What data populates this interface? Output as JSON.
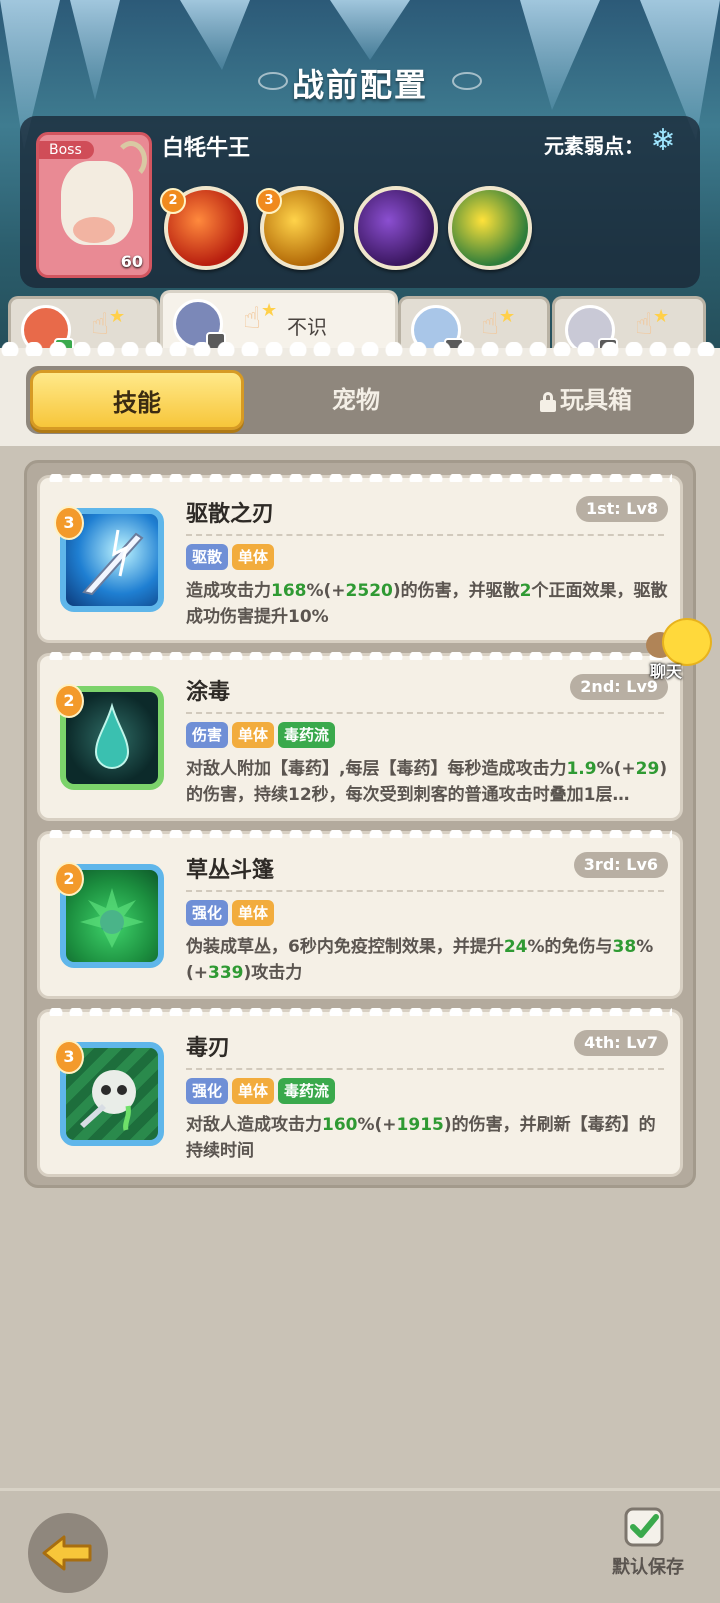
{
  "header": {
    "title": "战前配置"
  },
  "boss": {
    "tag": "Boss",
    "name": "白牦牛王",
    "level": "60",
    "element_weakness_label": "元素弱点：",
    "weakness_icon": "snowflake-icon",
    "skills": [
      {
        "icon": "fire-claw-icon",
        "badge": "2",
        "colors": [
          "#ff8a3d",
          "#b81e0f"
        ]
      },
      {
        "icon": "golden-swirl-icon",
        "badge": "3",
        "colors": [
          "#ffd34a",
          "#b36a08"
        ]
      },
      {
        "icon": "roaring-beast-icon",
        "badge": "",
        "colors": [
          "#8b4fd1",
          "#3b1760"
        ]
      },
      {
        "icon": "rock-golem-icon",
        "badge": "",
        "colors": [
          "#ffe23a",
          "#2f7d3a"
        ]
      }
    ]
  },
  "hero_tabs": [
    {
      "avatar_color": "#e86a4a",
      "label": ""
    },
    {
      "avatar_color": "#7b88b8",
      "label": "不识"
    },
    {
      "avatar_color": "#a9c6e8",
      "label": ""
    },
    {
      "avatar_color": "#c9c9d6",
      "label": ""
    }
  ],
  "category_tabs": {
    "skills": "技能",
    "pets": "宠物",
    "toybox": "玩具箱"
  },
  "skills": [
    {
      "name": "驱散之刃",
      "level_badge": "3",
      "rank": "1st: Lv8",
      "icon": "lightning-blade-icon",
      "frame": "blue",
      "tags": [
        {
          "text": "驱散",
          "color": "blue"
        },
        {
          "text": "单体",
          "color": "orange"
        }
      ],
      "desc_parts": [
        {
          "t": "造成攻击力",
          "hl": false
        },
        {
          "t": "168",
          "hl": true
        },
        {
          "t": "%(+",
          "hl": false
        },
        {
          "t": "2520",
          "hl": true
        },
        {
          "t": ")的伤害，并驱散",
          "hl": false
        },
        {
          "t": "2",
          "hl": true
        },
        {
          "t": "个正面效果，驱散成功伤害提升10%",
          "hl": false
        }
      ]
    },
    {
      "name": "涂毒",
      "level_badge": "2",
      "rank": "2nd: Lv9",
      "icon": "poison-drop-icon",
      "frame": "green",
      "tags": [
        {
          "text": "伤害",
          "color": "blue"
        },
        {
          "text": "单体",
          "color": "orange"
        },
        {
          "text": "毒药流",
          "color": "green"
        }
      ],
      "desc_parts": [
        {
          "t": "对敌人附加【毒药】,每层【毒药】每秒造成攻击力",
          "hl": false
        },
        {
          "t": "1.9",
          "hl": true
        },
        {
          "t": "%(+",
          "hl": false
        },
        {
          "t": "29",
          "hl": true
        },
        {
          "t": ")的伤害，持续12秒，每次受到刺客的普通攻击时叠加1层…",
          "hl": false
        }
      ]
    },
    {
      "name": "草丛斗篷",
      "level_badge": "2",
      "rank": "3rd: Lv6",
      "icon": "bush-cloak-icon",
      "frame": "blue",
      "tags": [
        {
          "text": "强化",
          "color": "blue"
        },
        {
          "text": "单体",
          "color": "orange"
        }
      ],
      "desc_parts": [
        {
          "t": "伪装成草丛，6秒内免疫控制效果，并提升",
          "hl": false
        },
        {
          "t": "24",
          "hl": true
        },
        {
          "t": "%的免伤与",
          "hl": false
        },
        {
          "t": "38",
          "hl": true
        },
        {
          "t": "%(+",
          "hl": false
        },
        {
          "t": "339",
          "hl": true
        },
        {
          "t": ")攻击力",
          "hl": false
        }
      ]
    },
    {
      "name": "毒刃",
      "level_badge": "3",
      "rank": "4th: Lv7",
      "icon": "poison-skull-blade-icon",
      "frame": "blue",
      "tags": [
        {
          "text": "强化",
          "color": "blue"
        },
        {
          "text": "单体",
          "color": "orange"
        },
        {
          "text": "毒药流",
          "color": "green"
        }
      ],
      "desc_parts": [
        {
          "t": "对敌人造成攻击力",
          "hl": false
        },
        {
          "t": "160",
          "hl": true
        },
        {
          "t": "%(+",
          "hl": false
        },
        {
          "t": "1915",
          "hl": true
        },
        {
          "t": ")的伤害，并刷新【毒药】的持续时间",
          "hl": false
        }
      ]
    }
  ],
  "chat": {
    "label": "聊天"
  },
  "footer": {
    "save_label": "默认保存",
    "save_checked": true
  }
}
